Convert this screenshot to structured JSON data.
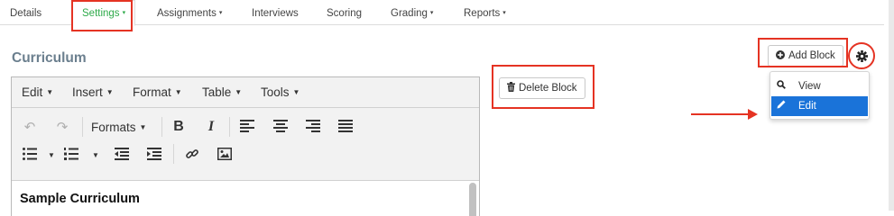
{
  "tabs": [
    {
      "label": "Details",
      "caret": ""
    },
    {
      "label": "Settings",
      "caret": "▾"
    },
    {
      "label": "Assignments",
      "caret": "▾"
    },
    {
      "label": "Interviews",
      "caret": ""
    },
    {
      "label": "Scoring",
      "caret": ""
    },
    {
      "label": "Grading",
      "caret": "▾"
    },
    {
      "label": "Reports",
      "caret": "▾"
    }
  ],
  "section_title": "Curriculum",
  "editor": {
    "menu": [
      "Edit",
      "Insert",
      "Format",
      "Table",
      "Tools"
    ],
    "formats_label": "Formats",
    "content_heading": "Sample Curriculum"
  },
  "buttons": {
    "delete_block": "Delete Block",
    "add_block": "Add Block"
  },
  "dropdown": {
    "items": [
      {
        "label": "View",
        "icon": "search-icon"
      },
      {
        "label": "Edit",
        "icon": "pencil-icon"
      }
    ]
  },
  "colors": {
    "active_tab": "#2eaa4a",
    "highlight": "#e53323",
    "selected_item": "#1a73d9",
    "title": "#6b7f8e"
  }
}
